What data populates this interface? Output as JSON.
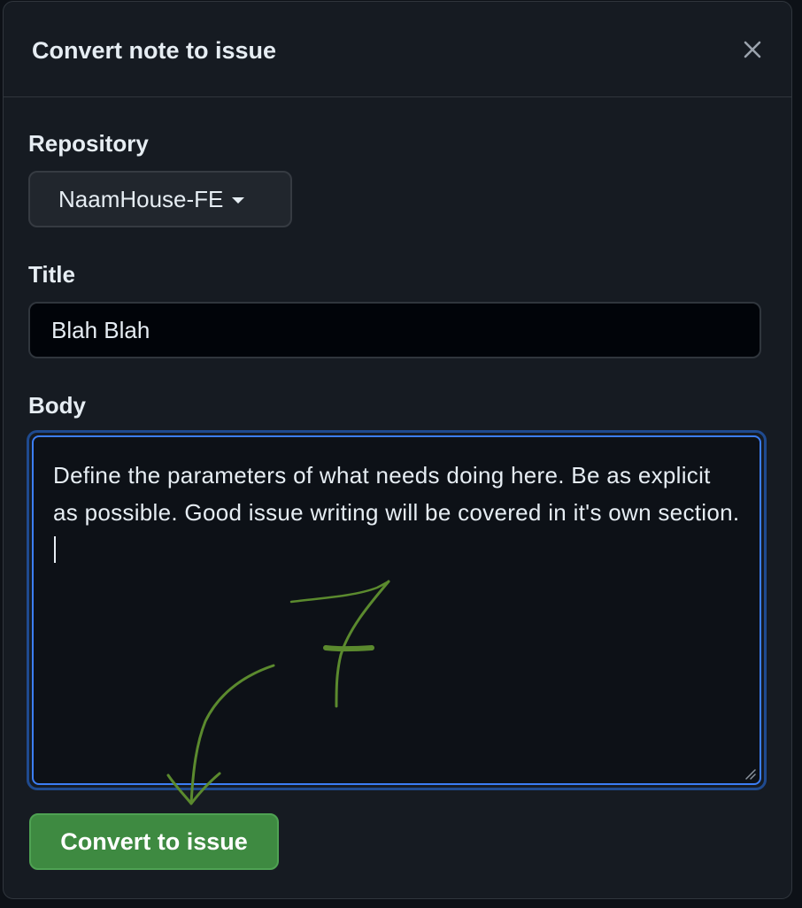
{
  "modal": {
    "title": "Convert note to issue",
    "close_icon": "close-icon"
  },
  "form": {
    "repository_label": "Repository",
    "repository_value": "NaamHouse-FE",
    "title_label": "Title",
    "title_value": "Blah Blah",
    "body_label": "Body",
    "body_value": "Define the parameters of what needs doing here. Be as explicit as possible. Good issue writing will be covered in it's own section.",
    "submit_label": "Convert to issue"
  },
  "annotation": {
    "handwritten_number": "7",
    "color": "#5b8a2e"
  },
  "colors": {
    "background": "#161b22",
    "focus": "#3c7ef5",
    "primary_button": "#3e8a41"
  }
}
